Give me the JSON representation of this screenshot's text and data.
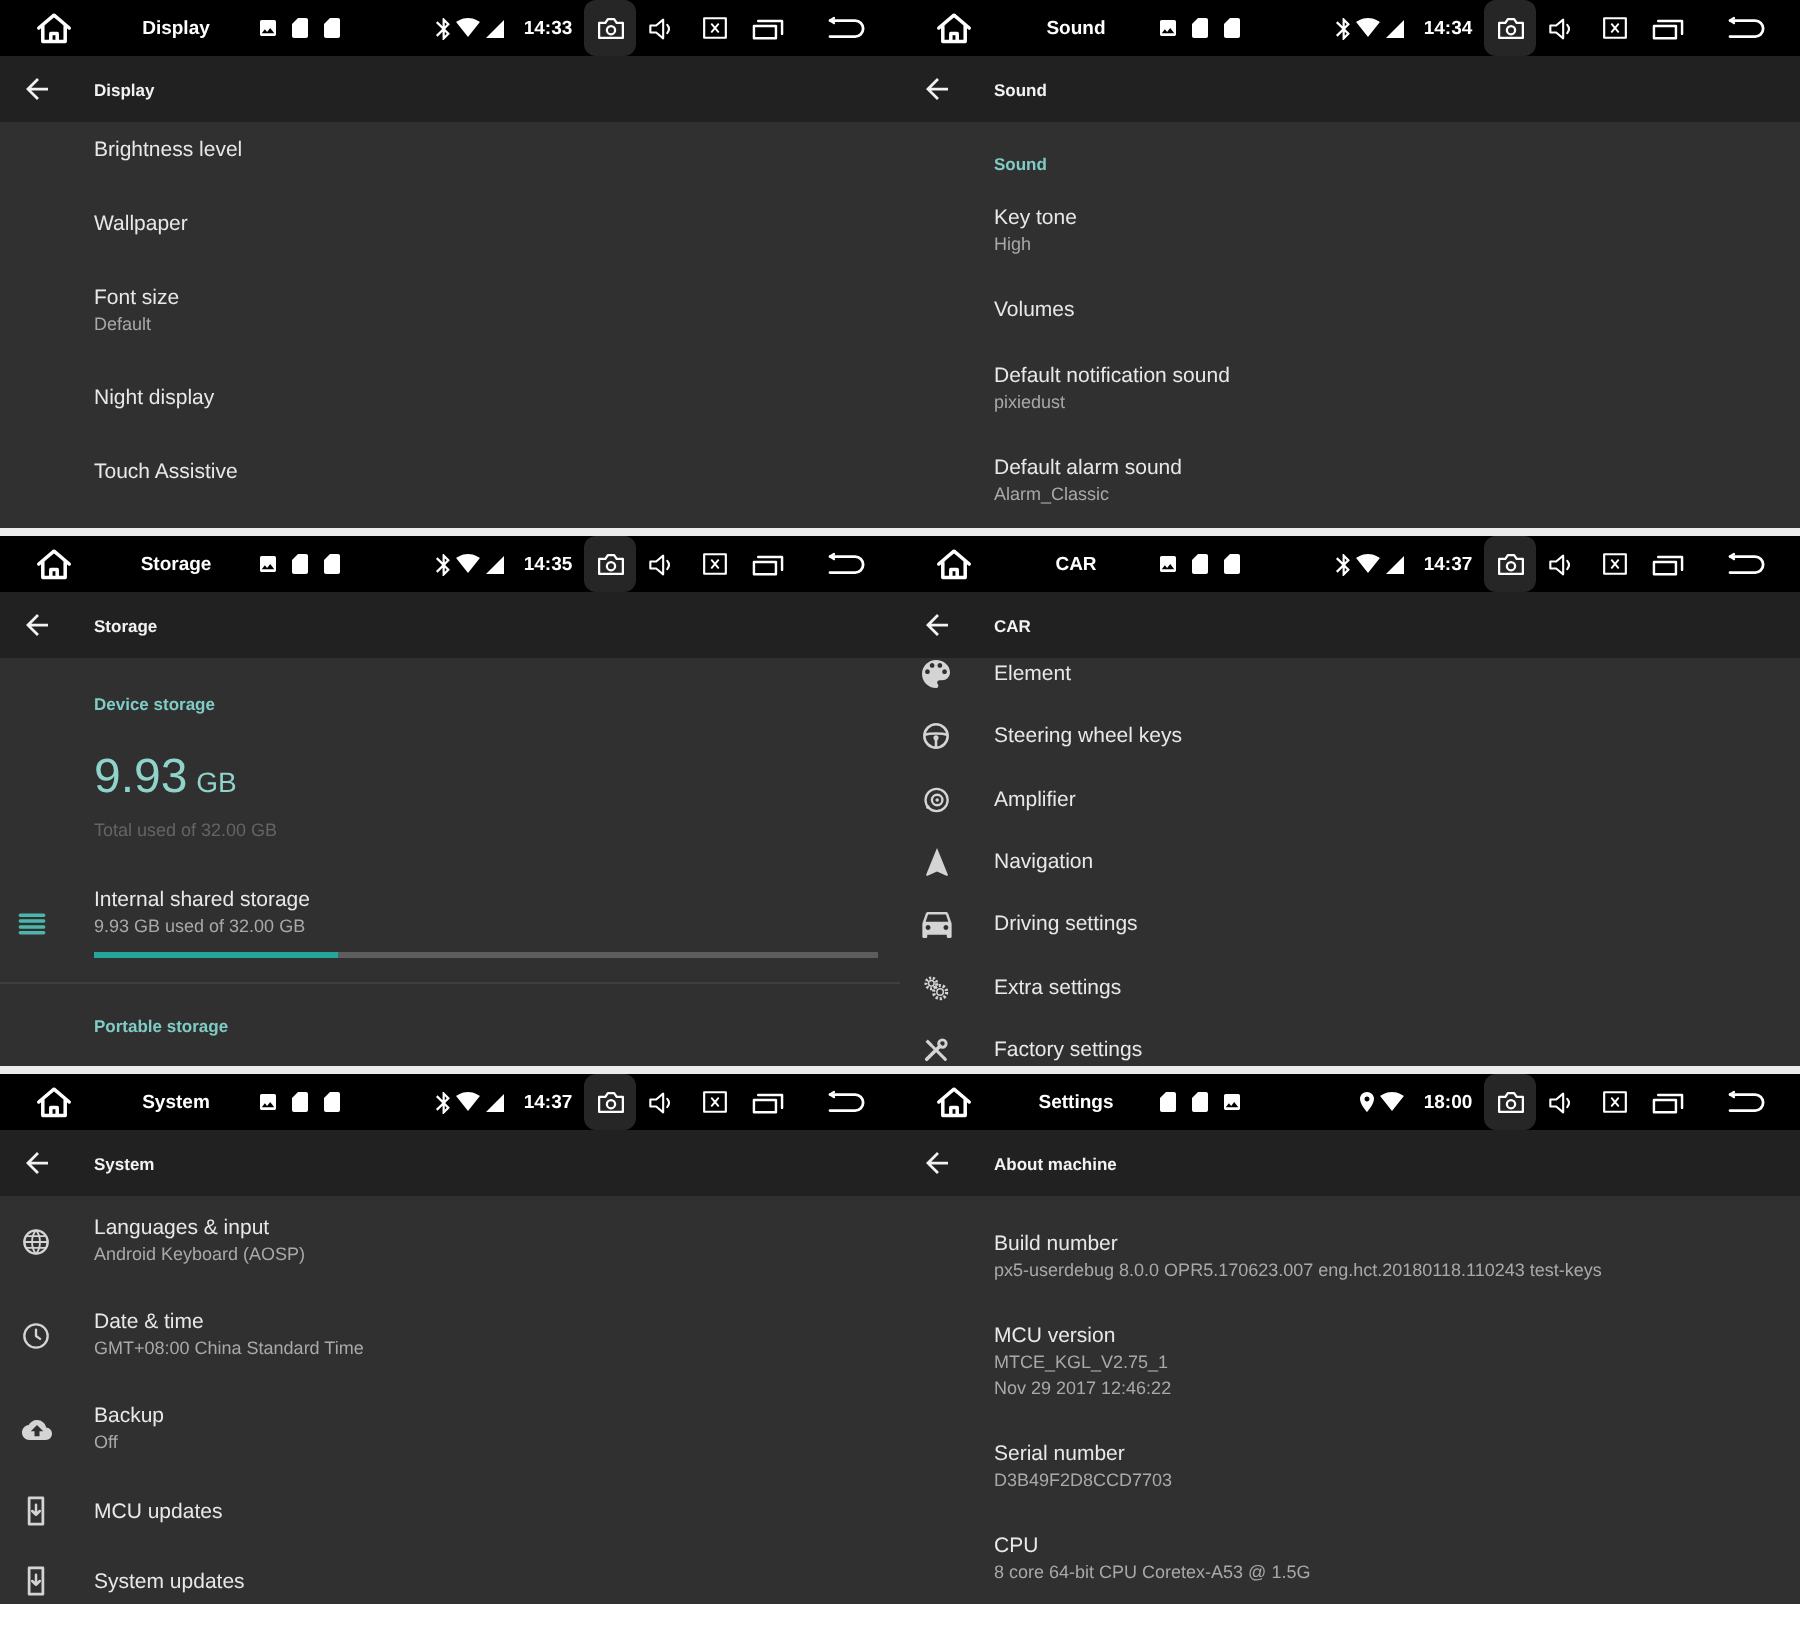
{
  "screens": [
    {
      "status_bar": {
        "title": "Display",
        "time": "14:33"
      },
      "app_bar": {
        "title": "Display"
      },
      "items": [
        {
          "kind": "item",
          "title": "Brightness level"
        },
        {
          "kind": "item",
          "title": "Wallpaper"
        },
        {
          "kind": "item",
          "title": "Font size",
          "summary": "Default"
        },
        {
          "kind": "item",
          "title": "Night display"
        },
        {
          "kind": "item",
          "title": "Touch Assistive"
        }
      ]
    },
    {
      "status_bar": {
        "title": "Sound",
        "time": "14:34"
      },
      "app_bar": {
        "title": "Sound"
      },
      "items": [
        {
          "kind": "header",
          "title": "Sound"
        },
        {
          "kind": "item",
          "title": "Key tone",
          "summary": "High"
        },
        {
          "kind": "item",
          "title": "Volumes"
        },
        {
          "kind": "item",
          "title": "Default notification sound",
          "summary": "pixiedust"
        },
        {
          "kind": "item",
          "title": "Default alarm sound",
          "summary": "Alarm_Classic"
        }
      ]
    },
    {
      "status_bar": {
        "title": "Storage",
        "time": "14:35"
      },
      "app_bar": {
        "title": "Storage"
      },
      "items": [
        {
          "kind": "header",
          "title": "Device storage"
        },
        {
          "kind": "usage",
          "amount": "9.93",
          "unit": "GB",
          "summary": "Total used of 32.00 GB"
        },
        {
          "kind": "volume",
          "title": "Internal shared storage",
          "summary": "9.93 GB used of 32.00 GB",
          "level": 0.31
        },
        {
          "kind": "header",
          "title": "Portable storage"
        }
      ]
    },
    {
      "status_bar": {
        "title": "CAR",
        "time": "14:37"
      },
      "app_bar": {
        "title": "CAR"
      },
      "items": [
        {
          "kind": "item",
          "title": "Element"
        },
        {
          "kind": "item",
          "title": "Steering wheel keys"
        },
        {
          "kind": "item",
          "title": "Amplifier"
        },
        {
          "kind": "item",
          "title": "Navigation"
        },
        {
          "kind": "item",
          "title": "Driving settings"
        },
        {
          "kind": "item",
          "title": "Extra settings"
        },
        {
          "kind": "item",
          "title": "Factory settings"
        }
      ]
    },
    {
      "status_bar": {
        "title": "System",
        "time": "14:37"
      },
      "app_bar": {
        "title": "System"
      },
      "items": [
        {
          "kind": "item",
          "title": "Languages & input",
          "summary": "Android Keyboard (AOSP)"
        },
        {
          "kind": "item",
          "title": "Date & time",
          "summary": "GMT+08:00 China Standard Time"
        },
        {
          "kind": "item",
          "title": "Backup",
          "summary": "Off"
        },
        {
          "kind": "item",
          "title": "MCU updates"
        },
        {
          "kind": "item",
          "title": "System updates"
        }
      ]
    },
    {
      "status_bar": {
        "title": "Settings",
        "time": "18:00"
      },
      "app_bar": {
        "title": "About machine"
      },
      "items": [
        {
          "kind": "item",
          "title": "Build number",
          "summary": "px5-userdebug 8.0.0 OPR5.170623.007 eng.hct.20180118.110243 test-keys"
        },
        {
          "kind": "item",
          "title": "MCU version",
          "summary": "MTCE_KGL_V2.75_1\nNov 29 2017 12:46:22"
        },
        {
          "kind": "item",
          "title": "Serial number",
          "summary": "D3B49F2D8CCD7703"
        },
        {
          "kind": "item",
          "title": "CPU",
          "summary": "8 core 64-bit CPU Coretex-A53 @ 1.5G"
        }
      ]
    }
  ]
}
